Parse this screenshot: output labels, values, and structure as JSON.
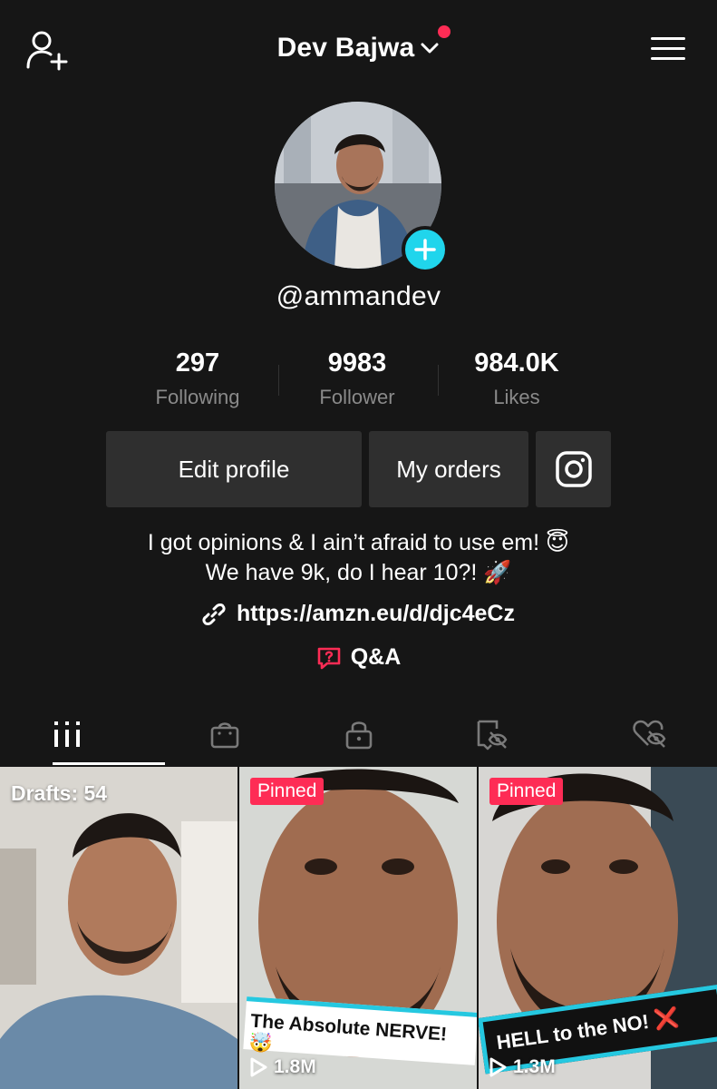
{
  "header": {
    "title": "Dev Bajwa",
    "notification_dot_color": "#fe2c55"
  },
  "profile": {
    "username": "@ammandev",
    "stats": [
      {
        "value": "297",
        "label": "Following"
      },
      {
        "value": "9983",
        "label": "Follower"
      },
      {
        "value": "984.0K",
        "label": "Likes"
      }
    ],
    "buttons": {
      "edit_profile": "Edit profile",
      "my_orders": "My orders",
      "instagram_icon": "instagram-icon"
    },
    "bio_line1": "I got opinions & I ain’t afraid to use em! 😇",
    "bio_line2": "We have 9k, do I hear 10?! 🚀",
    "link": "https://amzn.eu/d/djc4eCz",
    "qa_label": "Q&A"
  },
  "tabs": [
    {
      "icon": "videos-grid-icon",
      "active": true
    },
    {
      "icon": "shopping-bag-icon",
      "active": false
    },
    {
      "icon": "lock-icon",
      "active": false
    },
    {
      "icon": "tagged-hidden-icon",
      "active": false
    },
    {
      "icon": "liked-hidden-icon",
      "active": false
    }
  ],
  "videos": [
    {
      "badge": "Drafts: 54"
    },
    {
      "badge": "Pinned",
      "views": "1.8M",
      "caption": "The Absolute NERVE! 🤯"
    },
    {
      "badge": "Pinned",
      "views": "1.3M",
      "caption": "HELL to the NO!",
      "caption_mark": "❌"
    }
  ],
  "colors": {
    "background": "#161616",
    "accent_pink": "#fe2c55",
    "accent_cyan": "#20d5ec",
    "button_bg": "#2f2f2f",
    "muted_text": "#8a8a8a"
  }
}
